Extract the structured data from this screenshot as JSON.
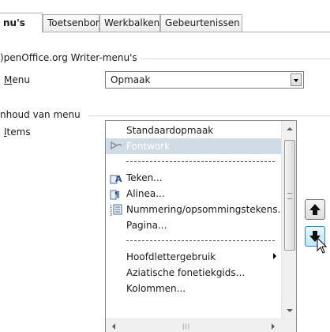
{
  "tabs": [
    {
      "label": "nu's",
      "active": true
    },
    {
      "label": "Toetsenbord",
      "active": false
    },
    {
      "label": "Werkbalken",
      "active": false
    },
    {
      "label": "Gebeurtenissen",
      "active": false
    }
  ],
  "menu_group": {
    "title": ")penOffice.org Writer-menu's",
    "menu_label_underline": "M",
    "menu_label_rest": "enu",
    "menu_value": "Opmaak"
  },
  "content_group": {
    "title": "nhoud van menu",
    "items_label_underline": "I",
    "items_label_rest": "tems"
  },
  "list_items": [
    {
      "label": "Standaardopmaak",
      "icon": "none"
    },
    {
      "label": "Fontwork",
      "icon": "fontwork-icon",
      "selected": true
    },
    {
      "label": "",
      "separator": true
    },
    {
      "label": "Teken...",
      "icon": "character-icon"
    },
    {
      "label": "Alinea...",
      "icon": "paragraph-icon"
    },
    {
      "label": "Nummering/opsommingstekens...",
      "icon": "numbering-icon"
    },
    {
      "label": "Pagina...",
      "icon": "none"
    },
    {
      "label": "",
      "separator": true
    },
    {
      "label": "Hoofdlettergebruik",
      "icon": "none",
      "submenu": true
    },
    {
      "label": "Aziatische fonetiekgids...",
      "icon": "none"
    },
    {
      "label": "Kolommen...",
      "icon": "none"
    }
  ],
  "move_buttons": {
    "up": "move-up",
    "down": "move-down"
  },
  "colors": {
    "selection": "#d0dbe6",
    "hover_button": "#bee6fd"
  }
}
